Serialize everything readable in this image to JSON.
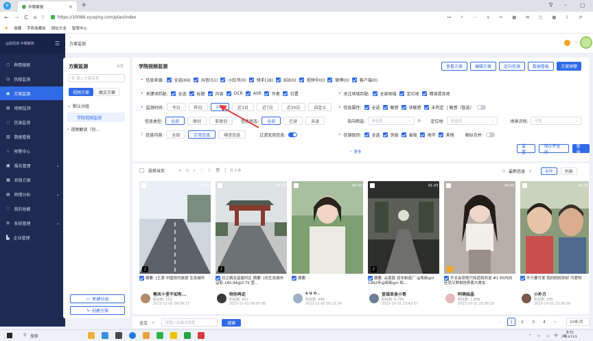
{
  "browser": {
    "tab_title": "中哪聚搜",
    "url": "https://10086.xyuqing.com/plan/index",
    "bookmarks": [
      "收藏",
      "手机收藏夹",
      "网址大全",
      "智慧中心"
    ]
  },
  "app": {
    "brand": "@舆情通 中哪聚搜",
    "page_tab": "方案监测"
  },
  "sidebar": {
    "items": [
      {
        "label": "舆情搜索"
      },
      {
        "label": "热搜监测"
      },
      {
        "label": "方案监测"
      },
      {
        "label": "地图监测"
      },
      {
        "label": "信源监测"
      },
      {
        "label": "数据看板"
      },
      {
        "label": "预警中心"
      },
      {
        "label": "报告管理"
      },
      {
        "label": "官微方案"
      },
      {
        "label": "舆情分析"
      },
      {
        "label": "我的收藏"
      },
      {
        "label": "系统管理"
      },
      {
        "label": "企业管理"
      }
    ]
  },
  "tree": {
    "title": "方案监测",
    "count": "2/3",
    "search_placeholder": "输入方案名称",
    "tabs": [
      "视频方案",
      "图文方案"
    ],
    "default_group": "默认分组",
    "plan_name": "学院视频监测",
    "other_group": "视频解读（勿...",
    "new_group_btn": "新建分组",
    "new_plan_btn": "创建方案"
  },
  "filter": {
    "title": "学院视频监测",
    "top_buttons": [
      "查看方案",
      "编辑方案",
      "定向信源",
      "数据看板",
      "方案预警"
    ],
    "source_label": "信息来源:",
    "sources": [
      "全选(69)",
      "抖音(51)",
      "小红书(0)",
      "快手(18)",
      "B站(0)",
      "视频号(0)",
      "微博(0)",
      "客户端(0)"
    ],
    "keyword_label": "关键词匹配:",
    "keywords": [
      "全选",
      "标题",
      "内容",
      "OCR",
      "ASR",
      "作者",
      "位置"
    ],
    "region_label": "关注地域匹配:",
    "regions": [
      "全部地域",
      "定位地",
      "精准提及地"
    ],
    "time_label": "监测时间:",
    "times": [
      "今日",
      "昨日",
      "24h",
      "近3日",
      "近7日",
      "近30日",
      "自定义"
    ],
    "attr_label": "信息属性:",
    "attrs": [
      "全选",
      "敏感",
      "非敏感",
      "未判定",
      "| 敏感（智选）"
    ],
    "type_label": "信息类型:",
    "types": [
      "全部",
      "原创",
      "非原创"
    ],
    "status_label": "信息状态:",
    "statuses": [
      "全部",
      "已读",
      "未读"
    ],
    "dir_label": "去向筛选:",
    "dir_placeholder": "请选择",
    "loc_label": "定位地:",
    "loc_placeholder": "请选择",
    "scene_label": "场景识别:",
    "scene_placeholder": "不限",
    "content_label": "信息内容:",
    "contents": [
      "全部",
      "正常信息",
      "噪音信息"
    ],
    "invalid_label": "过滤无效信息:",
    "level_label": "信源级别:",
    "levels": [
      "全选",
      "央级",
      "省级",
      "地市",
      "其他"
    ],
    "merge_label": "相似合并:",
    "more": "更多",
    "btn_reset": "重 置",
    "btn_save": "保存并查询",
    "btn_query": "查 询"
  },
  "results": {
    "select_page": "选择当页",
    "annotate": "共 0 条",
    "sort_label": "最新信息",
    "view_modes": [
      "卡片",
      "列表"
    ],
    "durations": [
      "00:19",
      "00:15",
      "00:43",
      "01:43",
      "00:00",
      "00:24"
    ],
    "cards": [
      {
        "caption": "摘要: [王源 中国现代故居 生态城市",
        "author": "春风十里不如有...",
        "followers": "粉丝数: 552",
        "date": "2023-11-01 09:16:17"
      },
      {
        "caption": "日之精及皆屋时区 摘要: [欣生态城市@和 140.94@0.75 营...",
        "author": "吻你再走",
        "followers": "粉丝数: 661",
        "date": "2023-11-01 08:07:08"
      },
      {
        "caption": "摘要: -",
        "author": "s u n .",
        "followers": "粉丝数: 446",
        "date": "2023-11-01 00:21:54"
      },
      {
        "caption": "摘要: 云南篮 迎车制造厂 @和新girl 1992年@和新girl 和...",
        "author": "宣城单身小哥",
        "followers": "粉丝数: 6,786",
        "date": "2023-10-31 23:42:57"
      },
      {
        "caption": "不太会穿搭只知道和你说 #1 85内向社恐又胖相信弄套大美女",
        "author": "阿萌妹晶",
        "followers": "粉丝数: 1,888",
        "date": "2023-10-31 23:38:19"
      },
      {
        "caption": "不只要可爱 我的妈妈你好 可爱呀",
        "author": "小朴方",
        "followers": "粉丝数: 295",
        "date": "2023-10-31 23:26:00"
      }
    ]
  },
  "pager": {
    "scope": "全文",
    "search_placeholder": "请输入关键词搜索",
    "search_btn": "搜索",
    "pages": [
      "1",
      "2",
      "3",
      "4"
    ],
    "page_size": "20条/页"
  },
  "taskbar": {
    "search": "搜索",
    "time": "8:51",
    "date": "2023/11/1"
  },
  "colors": {
    "accent": "#2f6be6",
    "sidebar": "#1e2a52",
    "required": "#e23c3c"
  }
}
